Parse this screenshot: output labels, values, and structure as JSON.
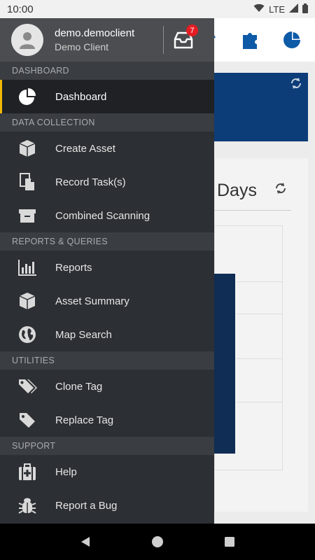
{
  "status_bar": {
    "time": "10:00",
    "network": "LTE"
  },
  "background": {
    "days_label": "Days"
  },
  "drawer": {
    "user": {
      "name": "demo.democlient",
      "client": "Demo Client"
    },
    "inbox_badge": "7",
    "accent_color": "#f2b705",
    "sections": [
      {
        "title": "DASHBOARD",
        "items": [
          {
            "label": "Dashboard",
            "icon": "pie-chart-icon",
            "active": true
          }
        ]
      },
      {
        "title": "DATA COLLECTION",
        "items": [
          {
            "label": "Create Asset",
            "icon": "cube-icon"
          },
          {
            "label": "Record Task(s)",
            "icon": "documents-icon"
          },
          {
            "label": "Combined Scanning",
            "icon": "archive-box-icon"
          }
        ]
      },
      {
        "title": "REPORTS & QUERIES",
        "items": [
          {
            "label": "Reports",
            "icon": "bar-chart-icon"
          },
          {
            "label": "Asset Summary",
            "icon": "cube-icon"
          },
          {
            "label": "Map Search",
            "icon": "globe-icon"
          }
        ]
      },
      {
        "title": "UTILITIES",
        "items": [
          {
            "label": "Clone Tag",
            "icon": "tags-icon"
          },
          {
            "label": "Replace Tag",
            "icon": "tag-icon"
          }
        ]
      },
      {
        "title": "SUPPORT",
        "items": [
          {
            "label": "Help",
            "icon": "medkit-icon"
          },
          {
            "label": "Report a Bug",
            "icon": "bug-icon"
          }
        ]
      }
    ]
  }
}
